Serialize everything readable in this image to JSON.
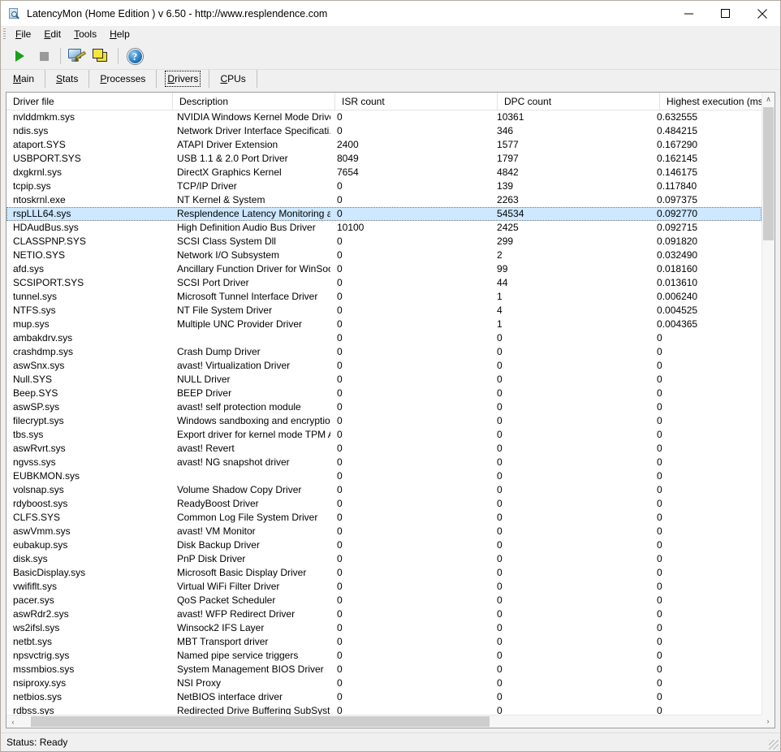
{
  "window": {
    "title": "LatencyMon  (Home Edition )  v 6.50 - http://www.resplendence.com",
    "icon": "app-document-magnifier-icon",
    "minimize_label": "Minimize",
    "maximize_label": "Maximize",
    "close_label": "Close"
  },
  "menu": {
    "items": [
      {
        "pre": "",
        "accel": "F",
        "post": "ile"
      },
      {
        "pre": "",
        "accel": "E",
        "post": "dit"
      },
      {
        "pre": "",
        "accel": "T",
        "post": "ools"
      },
      {
        "pre": "",
        "accel": "H",
        "post": "elp"
      }
    ]
  },
  "toolbar": {
    "buttons": [
      {
        "name": "start-monitoring-button",
        "icon": "play-icon",
        "label": "Start"
      },
      {
        "name": "stop-monitoring-button",
        "icon": "stop-icon",
        "label": "Stop"
      },
      {
        "name": "report-button",
        "icon": "report-monitor-pencil-icon",
        "label": "Report"
      },
      {
        "name": "windows-stack-button",
        "icon": "stacked-windows-icon",
        "label": "Windows"
      },
      {
        "name": "help-button",
        "icon": "help-question-icon",
        "label": "Help"
      }
    ]
  },
  "tabs": {
    "active": "Drivers",
    "items": [
      {
        "pre": "",
        "accel": "M",
        "post": "ain",
        "label": "Main"
      },
      {
        "pre": "",
        "accel": "S",
        "post": "tats",
        "label": "Stats"
      },
      {
        "pre": "",
        "accel": "P",
        "post": "rocesses",
        "label": "Processes"
      },
      {
        "pre": "",
        "accel": "D",
        "post": "rivers",
        "label": "Drivers"
      },
      {
        "pre": "",
        "accel": "C",
        "post": "PUs",
        "label": "CPUs"
      }
    ]
  },
  "table": {
    "columns": [
      "Driver file",
      "Description",
      "ISR count",
      "DPC count",
      "Highest execution (ms)"
    ],
    "selected_row_index": 7,
    "rows": [
      [
        "nvlddmkm.sys",
        "NVIDIA Windows Kernel Mode Drive...",
        "0",
        "10361",
        "0.632555"
      ],
      [
        "ndis.sys",
        "Network Driver Interface Specificati...",
        "0",
        "346",
        "0.484215"
      ],
      [
        "ataport.SYS",
        "ATAPI Driver Extension",
        "2400",
        "1577",
        "0.167290"
      ],
      [
        "USBPORT.SYS",
        "USB 1.1 & 2.0 Port Driver",
        "8049",
        "1797",
        "0.162145"
      ],
      [
        "dxgkrnl.sys",
        "DirectX Graphics Kernel",
        "7654",
        "4842",
        "0.146175"
      ],
      [
        "tcpip.sys",
        "TCP/IP Driver",
        "0",
        "139",
        "0.117840"
      ],
      [
        "ntoskrnl.exe",
        "NT Kernel & System",
        "0",
        "2263",
        "0.097375"
      ],
      [
        "rspLLL64.sys",
        "Resplendence Latency Monitoring a...",
        "0",
        "54534",
        "0.092770"
      ],
      [
        "HDAudBus.sys",
        "High Definition Audio Bus Driver",
        "10100",
        "2425",
        "0.092715"
      ],
      [
        "CLASSPNP.SYS",
        "SCSI Class System Dll",
        "0",
        "299",
        "0.091820"
      ],
      [
        "NETIO.SYS",
        "Network I/O Subsystem",
        "0",
        "2",
        "0.032490"
      ],
      [
        "afd.sys",
        "Ancillary Function Driver for WinSock",
        "0",
        "99",
        "0.018160"
      ],
      [
        "SCSIPORT.SYS",
        "SCSI Port Driver",
        "0",
        "44",
        "0.013610"
      ],
      [
        "tunnel.sys",
        "Microsoft Tunnel Interface Driver",
        "0",
        "1",
        "0.006240"
      ],
      [
        "NTFS.sys",
        "NT File System Driver",
        "0",
        "4",
        "0.004525"
      ],
      [
        "mup.sys",
        "Multiple UNC Provider Driver",
        "0",
        "1",
        "0.004365"
      ],
      [
        "ambakdrv.sys",
        "",
        "0",
        "0",
        "0"
      ],
      [
        "crashdmp.sys",
        "Crash Dump Driver",
        "0",
        "0",
        "0"
      ],
      [
        "aswSnx.sys",
        "avast! Virtualization Driver",
        "0",
        "0",
        "0"
      ],
      [
        "Null.SYS",
        "NULL Driver",
        "0",
        "0",
        "0"
      ],
      [
        "Beep.SYS",
        "BEEP Driver",
        "0",
        "0",
        "0"
      ],
      [
        "aswSP.sys",
        "avast! self protection module",
        "0",
        "0",
        "0"
      ],
      [
        "filecrypt.sys",
        "Windows sandboxing and encryptio...",
        "0",
        "0",
        "0"
      ],
      [
        "tbs.sys",
        "Export driver for kernel mode TPM API",
        "0",
        "0",
        "0"
      ],
      [
        "aswRvrt.sys",
        "avast! Revert",
        "0",
        "0",
        "0"
      ],
      [
        "ngvss.sys",
        "avast! NG snapshot driver",
        "0",
        "0",
        "0"
      ],
      [
        "EUBKMON.sys",
        "",
        "0",
        "0",
        "0"
      ],
      [
        "volsnap.sys",
        "Volume Shadow Copy Driver",
        "0",
        "0",
        "0"
      ],
      [
        "rdyboost.sys",
        "ReadyBoost Driver",
        "0",
        "0",
        "0"
      ],
      [
        "CLFS.SYS",
        "Common Log File System Driver",
        "0",
        "0",
        "0"
      ],
      [
        "aswVmm.sys",
        "avast! VM Monitor",
        "0",
        "0",
        "0"
      ],
      [
        "eubakup.sys",
        "Disk Backup Driver",
        "0",
        "0",
        "0"
      ],
      [
        "disk.sys",
        "PnP Disk Driver",
        "0",
        "0",
        "0"
      ],
      [
        "BasicDisplay.sys",
        "Microsoft Basic Display Driver",
        "0",
        "0",
        "0"
      ],
      [
        "vwififlt.sys",
        "Virtual WiFi Filter Driver",
        "0",
        "0",
        "0"
      ],
      [
        "pacer.sys",
        "QoS Packet Scheduler",
        "0",
        "0",
        "0"
      ],
      [
        "aswRdr2.sys",
        "avast! WFP Redirect Driver",
        "0",
        "0",
        "0"
      ],
      [
        "ws2ifsl.sys",
        "Winsock2 IFS Layer",
        "0",
        "0",
        "0"
      ],
      [
        "netbt.sys",
        "MBT Transport driver",
        "0",
        "0",
        "0"
      ],
      [
        "npsvctrig.sys",
        "Named pipe service triggers",
        "0",
        "0",
        "0"
      ],
      [
        "mssmbios.sys",
        "System Management BIOS Driver",
        "0",
        "0",
        "0"
      ],
      [
        "nsiproxy.sys",
        "NSI Proxy",
        "0",
        "0",
        "0"
      ],
      [
        "netbios.sys",
        "NetBIOS interface driver",
        "0",
        "0",
        "0"
      ],
      [
        "rdbss.sys",
        "Redirected Drive Buffering SubSyst...",
        "0",
        "0",
        "0"
      ]
    ]
  },
  "scrollbars": {
    "vertical_up": "∧",
    "vertical_down": "∨",
    "horizontal_left": "‹",
    "horizontal_right": "›"
  },
  "statusbar": {
    "text": "Status: Ready"
  },
  "colors": {
    "selection": "#cde8ff",
    "play": "#18a018",
    "stop": "#9a9a9a",
    "accent": "#1f74bd",
    "window_bg": "#f0f0f0",
    "list_bg": "#ffffff"
  }
}
